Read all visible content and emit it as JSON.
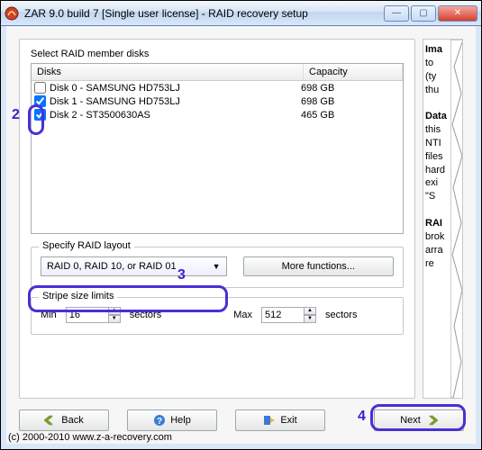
{
  "window": {
    "title": "ZAR 9.0 build 7 [Single user license] - RAID recovery setup"
  },
  "section_select_disks": "Select RAID member disks",
  "disk_headers": {
    "disks": "Disks",
    "capacity": "Capacity"
  },
  "disks": [
    {
      "name": "Disk 0 - SAMSUNG HD753LJ",
      "capacity": "698 GB",
      "checked": false
    },
    {
      "name": "Disk 1 - SAMSUNG HD753LJ",
      "capacity": "698 GB",
      "checked": true
    },
    {
      "name": "Disk 2 - ST3500630AS",
      "capacity": "465 GB",
      "checked": true
    }
  ],
  "raid_layout": {
    "label": "Specify RAID layout",
    "selected": "RAID 0, RAID 10, or RAID 01",
    "more_functions": "More functions..."
  },
  "stripe": {
    "label": "Stripe size limits",
    "min_label": "Min",
    "min_value": "16",
    "max_label": "Max",
    "max_value": "512",
    "unit": "sectors"
  },
  "buttons": {
    "back": "Back",
    "help": "Help",
    "exit": "Exit",
    "next": "Next"
  },
  "side": {
    "h1": "Ima",
    "l1a": "to",
    "l1b": "(ty",
    "l1c": "thu",
    "h2": "Data",
    "l2a": "this",
    "l2b": "NTI",
    "l2c": "files",
    "l2d": "hard",
    "l2e": "exi",
    "l2f": "\"S",
    "h3": "RAI",
    "l3a": "brok",
    "l3b": "arra",
    "l3c": "re"
  },
  "annotations": {
    "two": "2",
    "three": "3",
    "four": "4"
  },
  "footer": "(c) 2000-2010 www.z-a-recovery.com"
}
